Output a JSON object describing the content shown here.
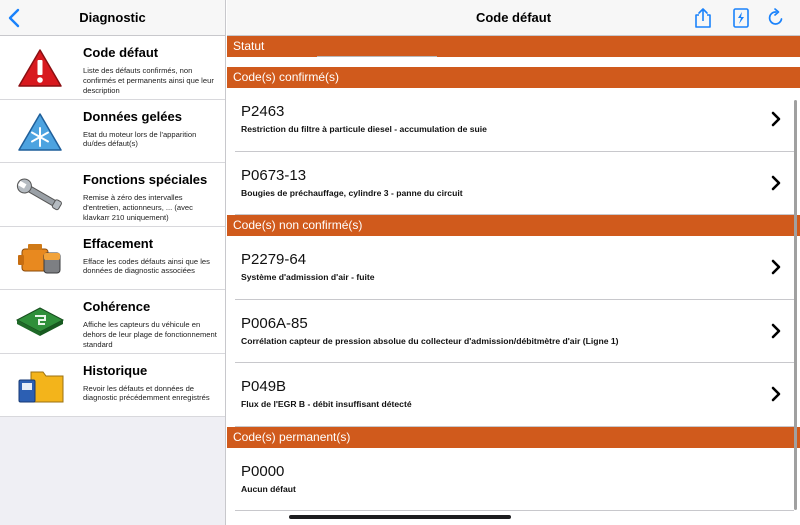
{
  "sidebar": {
    "title": "Diagnostic",
    "items": [
      {
        "title": "Code défaut",
        "desc": "Liste des défauts confirmés, non confirmés et permanents ainsi que leur description"
      },
      {
        "title": "Données gelées",
        "desc": "Etat du moteur lors de l'apparition du/des défaut(s)"
      },
      {
        "title": "Fonctions spéciales",
        "desc": "Remise à zéro des intervalles d'entretien, actionneurs, ... (avec klavkarr 210 uniquement)"
      },
      {
        "title": "Effacement",
        "desc": "Efface les codes défauts ainsi que les données de diagnostic associées"
      },
      {
        "title": "Cohérence",
        "desc": "Affiche les capteurs du véhicule en dehors de leur plage de fonctionnement standard"
      },
      {
        "title": "Historique",
        "desc": "Revoir les défauts et données de diagnostic précédemment enregistrés"
      }
    ]
  },
  "main": {
    "title": "Code défaut",
    "sections": {
      "status": "Statut",
      "confirmed": "Code(s) confirmé(s)",
      "unconfirmed": "Code(s) non confirmé(s)",
      "permanent": "Code(s) permanent(s)"
    },
    "confirmed_codes": [
      {
        "code": "P2463",
        "desc": "Restriction du filtre à particule diesel - accumulation de suie"
      },
      {
        "code": "P0673-13",
        "desc": "Bougies de préchauffage, cylindre 3 - panne du circuit"
      }
    ],
    "unconfirmed_codes": [
      {
        "code": "P2279-64",
        "desc": "Système d'admission d'air - fuite"
      },
      {
        "code": "P006A-85",
        "desc": "Corrélation capteur de pression absolue du collecteur d'admission/débitmètre d'air (Ligne 1)"
      },
      {
        "code": "P049B",
        "desc": "Flux de l'EGR B - débit insuffisant détecté"
      }
    ],
    "permanent_codes": [
      {
        "code": "P0000",
        "desc": "Aucun défaut"
      }
    ]
  },
  "colors": {
    "accent": "#d05a1c",
    "ios_blue": "#1a82fb"
  },
  "icons": {
    "back": "chevron-left-icon",
    "share": "share-icon",
    "report": "report-icon",
    "refresh": "refresh-icon"
  }
}
